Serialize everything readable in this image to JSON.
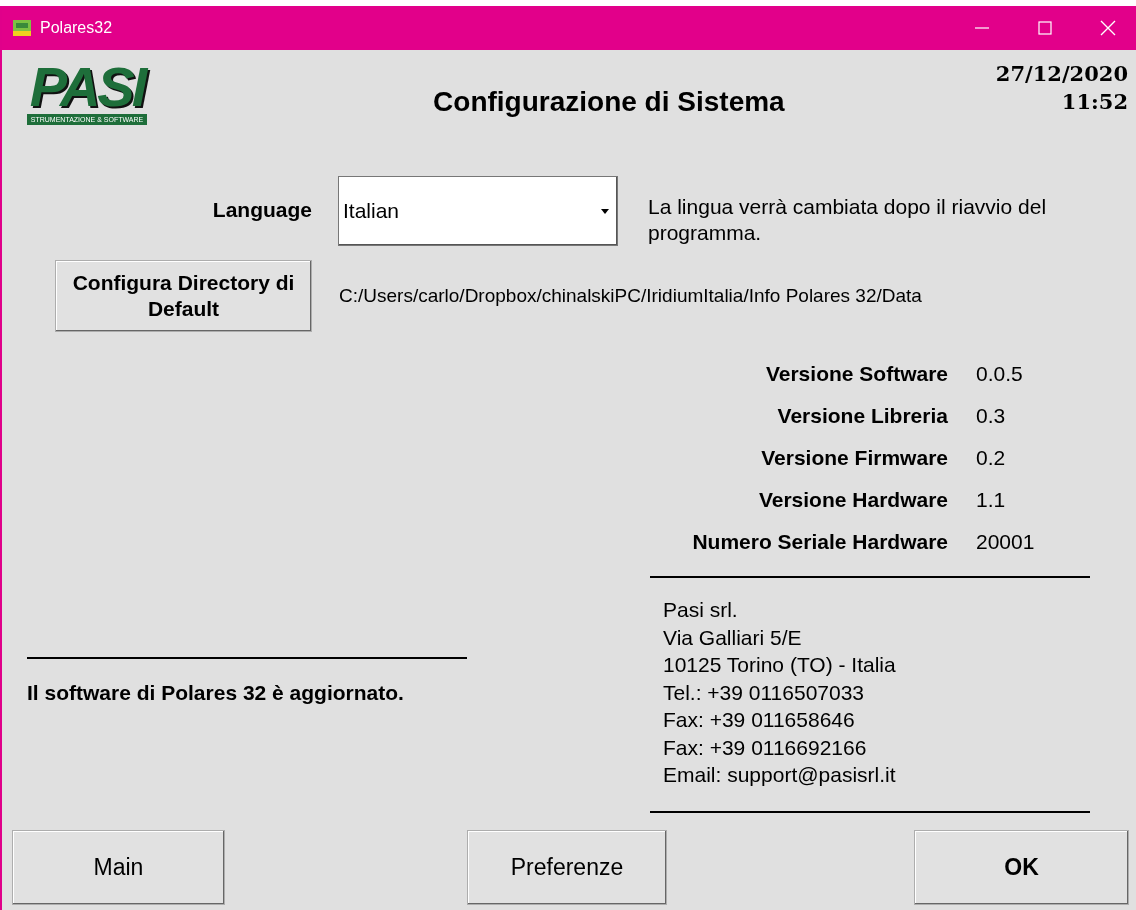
{
  "window": {
    "title": "Polares32"
  },
  "logo": {
    "letters": "PASI",
    "caption": "STRUMENTAZIONE & SOFTWARE"
  },
  "header": {
    "title": "Configurazione di Sistema",
    "date": "27/12/2020",
    "time": "11:52"
  },
  "language": {
    "label": "Language",
    "value": "Italian",
    "note": "La lingua verrà cambiata dopo il riavvio del programma."
  },
  "directory": {
    "button": "Configura Directory di Default",
    "path": "C:/Users/carlo/Dropbox/chinalskiPC/IridiumItalia/Info Polares 32/Data"
  },
  "versions": [
    {
      "label": "Versione Software",
      "value": "0.0.5"
    },
    {
      "label": "Versione Libreria",
      "value": "0.3"
    },
    {
      "label": "Versione Firmware",
      "value": "0.2"
    },
    {
      "label": "Versione Hardware",
      "value": "1.1"
    },
    {
      "label": "Numero Seriale Hardware",
      "value": "20001"
    }
  ],
  "status": "Il software di Polares 32 è aggiornato.",
  "contact": [
    "Pasi srl.",
    "Via Galliari 5/E",
    "10125 Torino (TO) - Italia",
    "Tel.: +39 0116507033",
    "Fax: +39 011658646",
    "Fax: +39 0116692166",
    "Email: support@pasisrl.it"
  ],
  "buttons": [
    "Main",
    "Preferenze",
    "OK"
  ]
}
